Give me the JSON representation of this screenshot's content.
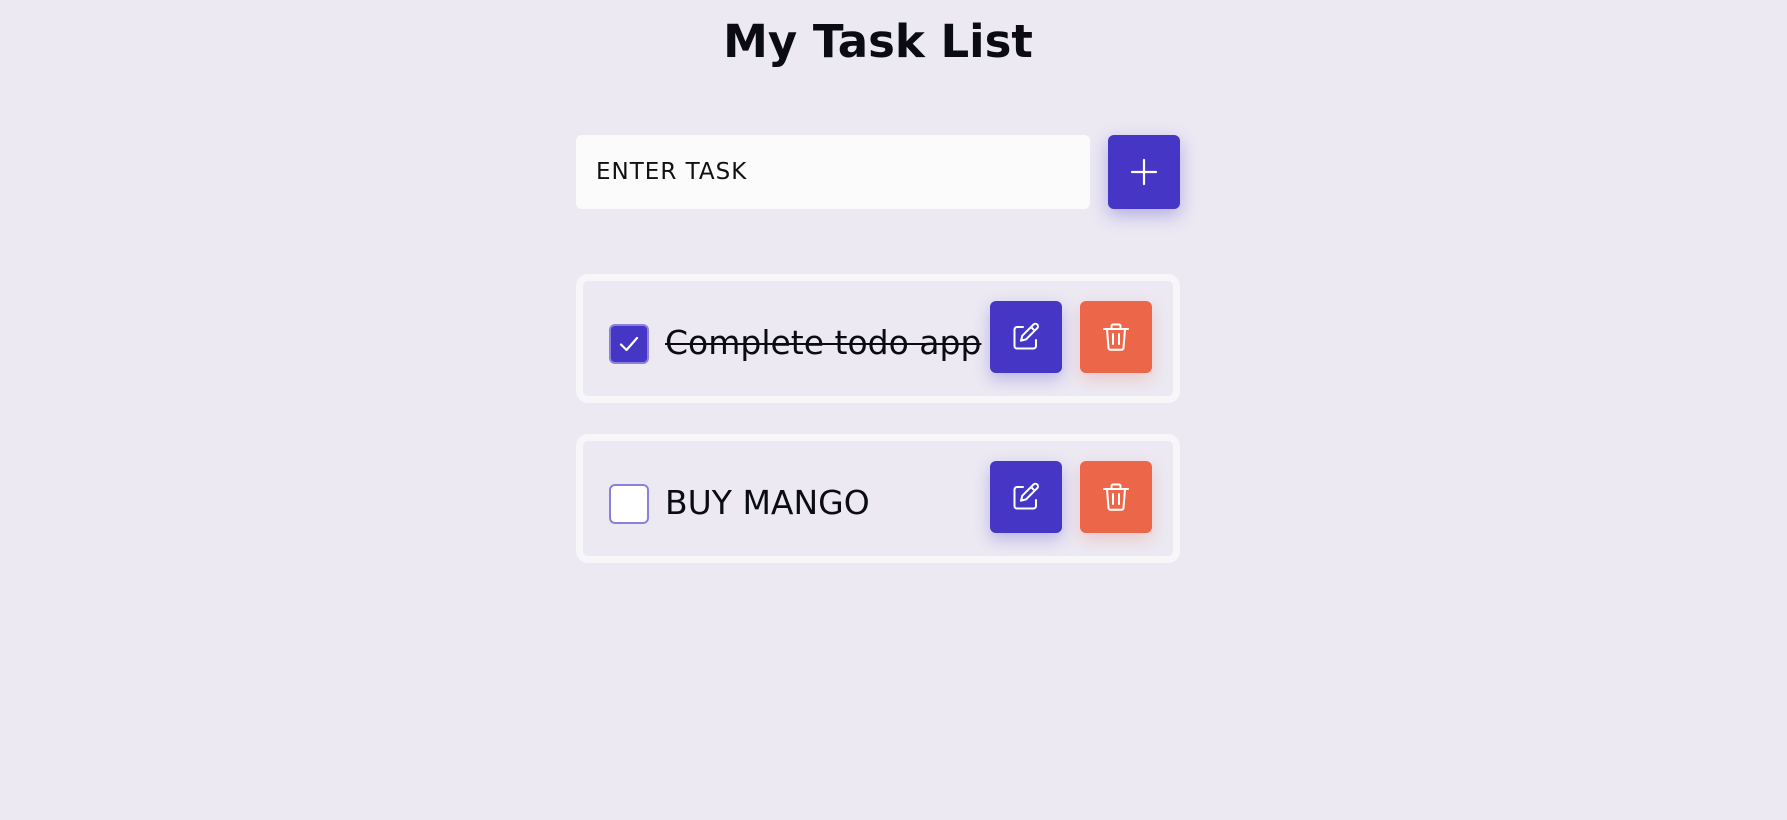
{
  "header": {
    "title": "My Task List"
  },
  "new_task": {
    "placeholder": "ENTER TASK",
    "value": "",
    "add_icon": "plus-icon"
  },
  "tasks": [
    {
      "text": "Complete todo app",
      "completed": true,
      "edit_icon": "edit-icon",
      "delete_icon": "trash-icon"
    },
    {
      "text": "BUY MANGO",
      "completed": false,
      "edit_icon": "edit-icon",
      "delete_icon": "trash-icon"
    }
  ],
  "colors": {
    "background": "#ece9f3",
    "primary": "#4636c6",
    "danger": "#ec6749",
    "input_background": "#fbfbfb"
  }
}
